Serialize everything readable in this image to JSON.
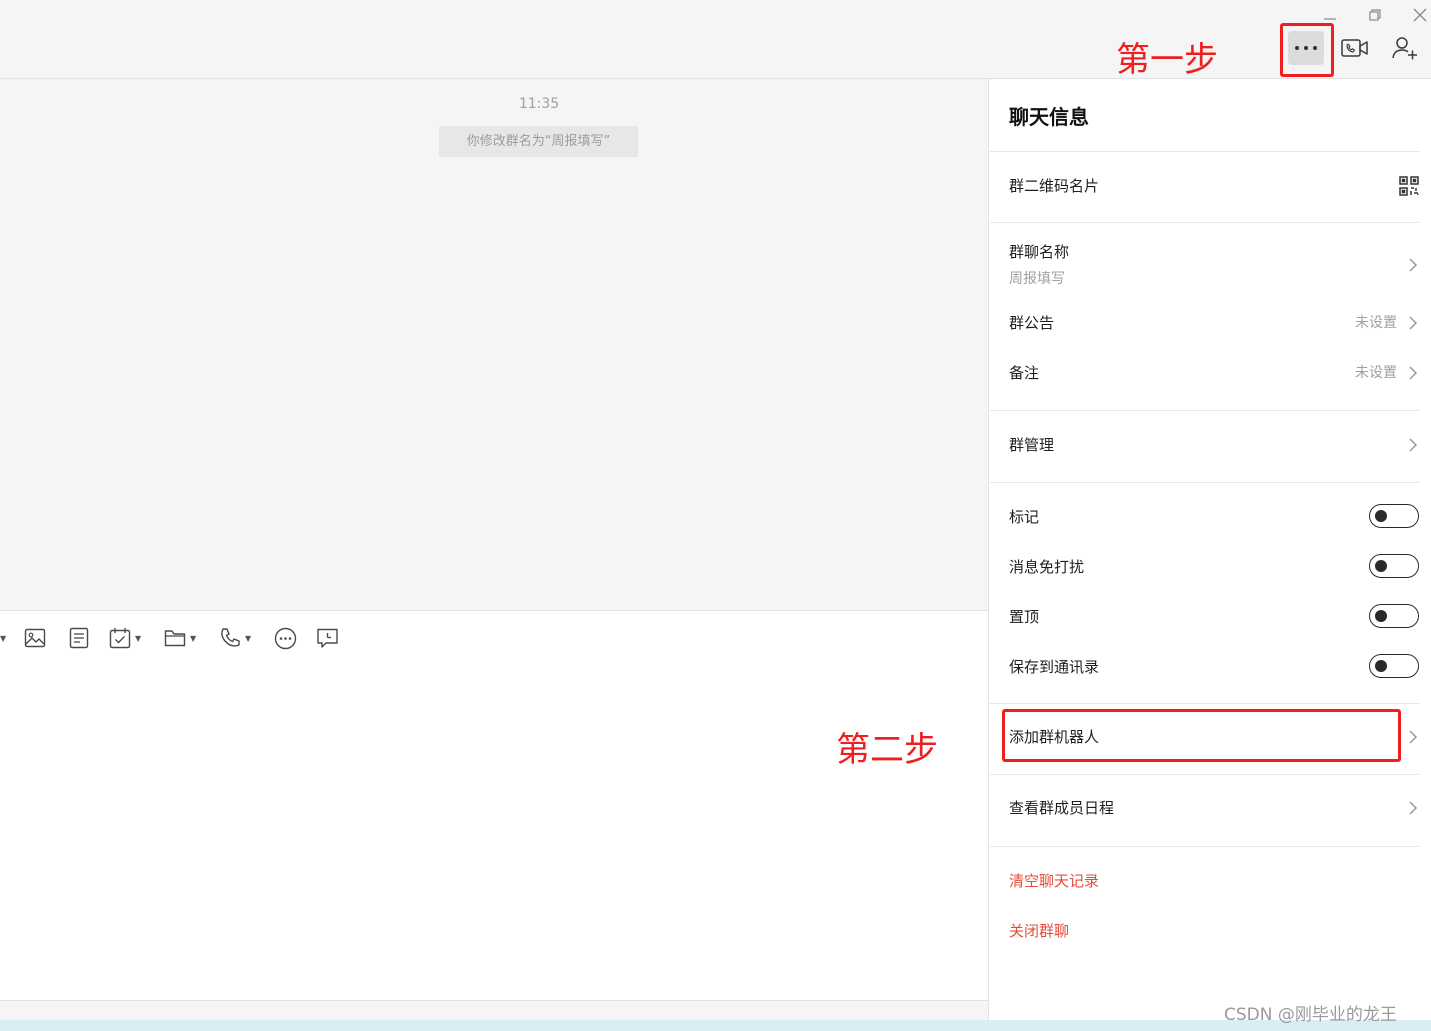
{
  "chat": {
    "timestamp": "11:35",
    "system_message": "你修改群名为“周报填写”"
  },
  "panel": {
    "title": "聊天信息",
    "qr_label": "群二维码名片",
    "group_name_label": "群聊名称",
    "group_name_value": "周报填写",
    "announcement_label": "群公告",
    "announcement_value": "未设置",
    "remark_label": "备注",
    "remark_value": "未设置",
    "manage_label": "群管理",
    "toggles": {
      "mark": {
        "label": "标记",
        "on": false
      },
      "mute": {
        "label": "消息免打扰",
        "on": false
      },
      "pin": {
        "label": "置顶",
        "on": false
      },
      "save_contacts": {
        "label": "保存到通讯录",
        "on": false
      }
    },
    "add_bot_label": "添加群机器人",
    "member_schedule_label": "查看群成员日程",
    "clear_history_label": "清空聊天记录",
    "close_group_label": "关闭群聊",
    "danger_color": "#e34c3c"
  },
  "annotations": {
    "step1": "第一步",
    "step2": "第二步",
    "color": "#ef1f1f"
  },
  "icons": {
    "window": [
      "minimize-icon",
      "restore-icon",
      "close-icon"
    ],
    "header": [
      "more-icon",
      "video-call-icon",
      "add-member-icon"
    ],
    "toolbar": [
      "image-icon",
      "document-icon",
      "schedule-icon",
      "folder-icon",
      "phone-icon",
      "more-circle-icon",
      "feedback-icon"
    ]
  },
  "watermark": "CSDN @刚毕业的龙王"
}
